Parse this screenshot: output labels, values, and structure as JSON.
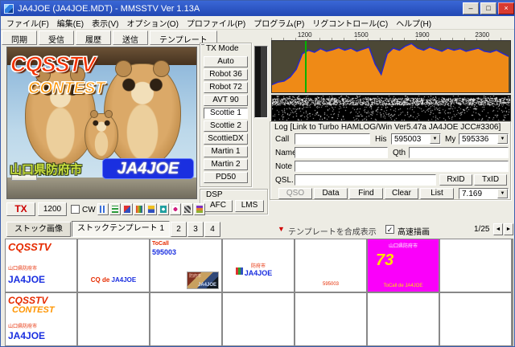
{
  "window": {
    "title": "JA4JOE (JA4JOE.MDT) - MMSSTV Ver 1.13A",
    "minimize": "–",
    "maximize": "□",
    "close": "×"
  },
  "menu_items": [
    "ファイル(F)",
    "編集(E)",
    "表示(V)",
    "オプション(O)",
    "プロファイル(P)",
    "プログラム(P)",
    "リグコントロール(C)",
    "ヘルプ(H)"
  ],
  "main_tabs": [
    "同期",
    "受信",
    "履歴",
    "送信",
    "テンプレート"
  ],
  "tx_image": {
    "title1": "CQSSTV",
    "title2": "CONTEST",
    "city": "山口県防府市",
    "callsign": "JA4JOE"
  },
  "tx_mode": {
    "label": "TX Mode",
    "modes": [
      "Auto",
      "Robot 36",
      "Robot 72",
      "AVT 90",
      "Scottie 1",
      "Scottie 2",
      "ScottieDX",
      "Martin 1",
      "Martin 2",
      "PD50"
    ],
    "selected": "Scottie 1"
  },
  "dsp": {
    "label": "DSP",
    "afc": "AFC",
    "lms": "LMS"
  },
  "spectrum": {
    "freq_labels": [
      "1200",
      "1500",
      "1900",
      "2300"
    ],
    "freq_positions_pct": [
      14,
      37.5,
      63,
      88
    ],
    "marker_freq": "1200",
    "points": [
      0.15,
      0.2,
      0.22,
      0.3,
      0.45,
      0.75,
      0.82,
      0.78,
      0.85,
      0.8,
      0.83,
      0.87,
      0.82,
      0.86,
      0.8,
      0.84,
      0.88,
      0.55,
      0.35,
      0.75,
      0.86,
      0.82,
      0.9,
      0.95,
      0.86,
      0.82,
      0.88,
      0.84,
      0.8,
      0.86,
      0.82,
      0.85,
      0.8,
      0.83,
      0.86,
      0.8,
      0.78,
      0.82,
      0.76,
      0.7
    ]
  },
  "log": {
    "title": "Log [Link to Turbo HAMLOG/Win Ver5.47a JA4JOE JCC#3306]",
    "call_label": "Call",
    "his_label": "His",
    "his_value": "595003",
    "my_label": "My",
    "my_value": "595336",
    "name_label": "Name",
    "name_value": "",
    "qth_label": "Qth",
    "qth_value": "",
    "note_label": "Note",
    "note_value": "",
    "qsl_label": "QSL.",
    "qsl_value": "",
    "rxid_label": "RxID",
    "txid_label": "TxID",
    "qso_label": "QSO",
    "data_label": "Data",
    "find_label": "Find",
    "clear_label": "Clear",
    "list_label": "List",
    "freq_value": "7.169"
  },
  "tx_bar": {
    "tx": "TX",
    "tone": "1200",
    "cw": "CW"
  },
  "tool_icons": [
    "tx-tool-1",
    "tx-tool-2",
    "tx-tool-3",
    "tx-tool-4",
    "tx-tool-5",
    "tx-tool-6",
    "tx-tool-7",
    "tx-tool-8",
    "tx-tool-9"
  ],
  "stock": {
    "tab_stock": "ストック画像",
    "tab_template1": "ストックテンプレート 1",
    "tab_2": "2",
    "tab_3": "3",
    "tab_4": "4",
    "overlay_label": "テンプレートを合成表示",
    "fast_label": "高速描画",
    "page": "1/25"
  },
  "glyphs": {
    "dropdown": "▼",
    "check": "✓",
    "overlay_marker": "▼",
    "prev": "◄",
    "next": "►"
  },
  "thumbs": {
    "c1": {
      "line1": "CQSSTV",
      "city": "山口県防府市",
      "call": "JA4JOE"
    },
    "c2": {
      "text1": "CQ de ",
      "text2": "JA4JOE"
    },
    "c3": {
      "line1": "ToCall",
      "line2": "595003",
      "mini_city": "防府市",
      "mini_call": "JA4JOE"
    },
    "c4": {
      "city": "防府市",
      "call": "JA4JOE"
    },
    "c5": {
      "num": "595003"
    },
    "c6": {
      "city": "山口県防府市",
      "big": "73",
      "bottom": "ToCall de JA4JOE"
    },
    "c8": {
      "line1": "CQSSTV",
      "line2": "CONTEST",
      "city": "山口県防府市",
      "call": "JA4JOE"
    }
  },
  "colors": {
    "titlebar": "#2c55c8",
    "close_button": "#d83a30",
    "spectrum_fill": "#ef8a16",
    "spectrum_line": "#2828c8",
    "marker_green": "#00b400",
    "thumb6_bg": "#fa00fa",
    "tx_label_red": "#cc0000",
    "cq_red": "#e62b00",
    "contest_orange": "#ff9500",
    "callsign_blue": "#1a2fe0"
  }
}
